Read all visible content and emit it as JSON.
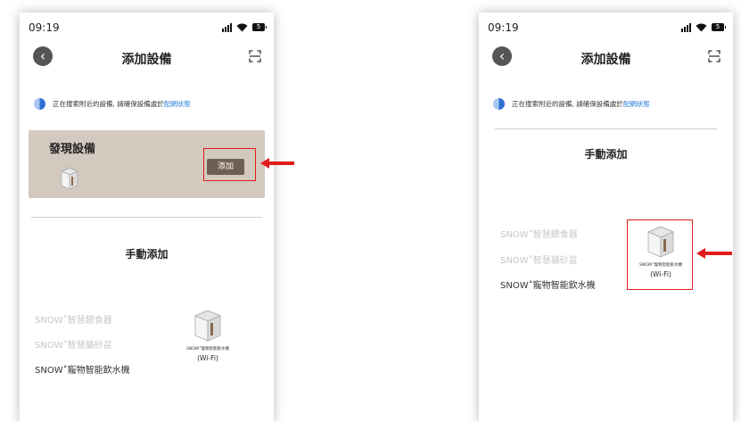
{
  "status_bar": {
    "time": "09:19",
    "battery": "5"
  },
  "header": {
    "title": "添加設備"
  },
  "search_status": {
    "text": "正在搜索附近的設備,  請確保設備處於",
    "link": "配網狀態"
  },
  "found_section": {
    "title": "發現設備",
    "add_button": "添加"
  },
  "manual_section": {
    "title": "手動添加"
  },
  "categories": [
    {
      "label": "SNOW˚智慧餵食器"
    },
    {
      "label": "SNOW˚智慧貓砂盆"
    },
    {
      "label": "SNOW˚寵物智能飲水機"
    }
  ],
  "device": {
    "name": "SNOW˚寵物智能飲水機",
    "connection": "(Wi-Fi)"
  },
  "colors": {
    "highlight": "#e21b1b",
    "link": "#2f83d8",
    "found_bg": "#d3c9bf",
    "button_bg": "#6f5f52"
  }
}
